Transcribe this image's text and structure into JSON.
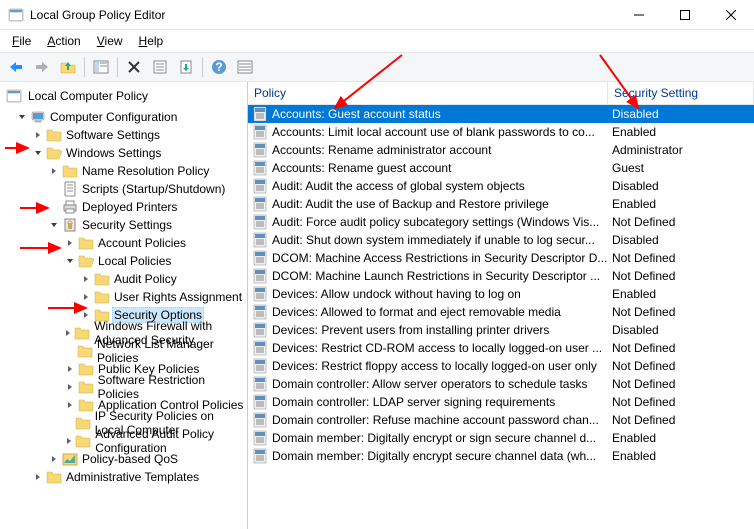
{
  "window": {
    "title": "Local Group Policy Editor"
  },
  "menu": {
    "file": "File",
    "action": "Action",
    "view": "View",
    "help": "Help"
  },
  "tree": {
    "root": "Local Computer Policy",
    "computer_config": "Computer Configuration",
    "software_settings": "Software Settings",
    "windows_settings": "Windows Settings",
    "name_resolution": "Name Resolution Policy",
    "scripts": "Scripts (Startup/Shutdown)",
    "deployed_printers": "Deployed Printers",
    "security_settings": "Security Settings",
    "account_policies": "Account Policies",
    "local_policies": "Local Policies",
    "audit_policy": "Audit Policy",
    "user_rights": "User Rights Assignment",
    "security_options": "Security Options",
    "windows_firewall": "Windows Firewall with Advanced Security",
    "network_list": "Network List Manager Policies",
    "public_key": "Public Key Policies",
    "software_restriction": "Software Restriction Policies",
    "app_control": "Application Control Policies",
    "ip_security": "IP Security Policies on Local Computer",
    "advanced_audit": "Advanced Audit Policy Configuration",
    "policy_qos": "Policy-based QoS",
    "admin_templates": "Administrative Templates"
  },
  "list": {
    "header_policy": "Policy",
    "header_setting": "Security Setting",
    "rows": [
      {
        "policy": "Accounts: Guest account status",
        "setting": "Disabled",
        "selected": true
      },
      {
        "policy": "Accounts: Limit local account use of blank passwords to co...",
        "setting": "Enabled"
      },
      {
        "policy": "Accounts: Rename administrator account",
        "setting": "Administrator"
      },
      {
        "policy": "Accounts: Rename guest account",
        "setting": "Guest"
      },
      {
        "policy": "Audit: Audit the access of global system objects",
        "setting": "Disabled"
      },
      {
        "policy": "Audit: Audit the use of Backup and Restore privilege",
        "setting": "Enabled"
      },
      {
        "policy": "Audit: Force audit policy subcategory settings (Windows Vis...",
        "setting": "Not Defined"
      },
      {
        "policy": "Audit: Shut down system immediately if unable to log secur...",
        "setting": "Disabled"
      },
      {
        "policy": "DCOM: Machine Access Restrictions in Security Descriptor D...",
        "setting": "Not Defined"
      },
      {
        "policy": "DCOM: Machine Launch Restrictions in Security Descriptor ...",
        "setting": "Not Defined"
      },
      {
        "policy": "Devices: Allow undock without having to log on",
        "setting": "Enabled"
      },
      {
        "policy": "Devices: Allowed to format and eject removable media",
        "setting": "Not Defined"
      },
      {
        "policy": "Devices: Prevent users from installing printer drivers",
        "setting": "Disabled"
      },
      {
        "policy": "Devices: Restrict CD-ROM access to locally logged-on user ...",
        "setting": "Not Defined"
      },
      {
        "policy": "Devices: Restrict floppy access to locally logged-on user only",
        "setting": "Not Defined"
      },
      {
        "policy": "Domain controller: Allow server operators to schedule tasks",
        "setting": "Not Defined"
      },
      {
        "policy": "Domain controller: LDAP server signing requirements",
        "setting": "Not Defined"
      },
      {
        "policy": "Domain controller: Refuse machine account password chan...",
        "setting": "Not Defined"
      },
      {
        "policy": "Domain member: Digitally encrypt or sign secure channel d...",
        "setting": "Enabled"
      },
      {
        "policy": "Domain member: Digitally encrypt secure channel data (wh...",
        "setting": "Enabled"
      }
    ]
  }
}
